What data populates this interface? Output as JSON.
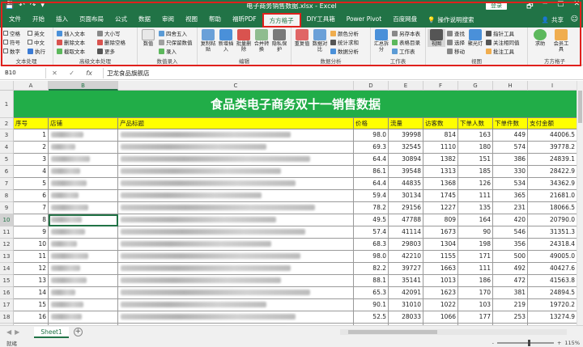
{
  "app": {
    "title": "电子商务销售数据.xlsx - Excel",
    "login_label": "登录",
    "quick_access": [
      "💾",
      "↶",
      "↷",
      "▾"
    ],
    "window_controls": [
      "🗗",
      "─",
      "▢",
      "✕"
    ]
  },
  "tabs": {
    "items": [
      "文件",
      "开始",
      "插入",
      "页面布局",
      "公式",
      "数据",
      "审阅",
      "视图",
      "帮助",
      "福昕PDF",
      "方方格子",
      "DIY工具箱",
      "Power Pivot",
      "百度网盘"
    ],
    "active": "方方格子",
    "search_label": "操作说明搜索",
    "share_label": "共享"
  },
  "ribbon": {
    "text_group": {
      "label": "文本处理",
      "checks": [
        "空格",
        "英文",
        "符号",
        "中文",
        "数字",
        "执行"
      ]
    },
    "adv_text_group": {
      "label": "高级文本处理",
      "items": [
        "插入文本",
        "大小写",
        "删除文本",
        "删除空格",
        "截取文本",
        "更多"
      ]
    },
    "number_group": {
      "label": "数值录入",
      "items": [
        "四舍五入",
        "只保留数值",
        "录入"
      ],
      "big": "数值"
    },
    "edit_group": {
      "label": "编辑",
      "bigs": [
        "复制粘贴",
        "新增插入",
        "批量删除",
        "合并转换",
        "隐私保护"
      ]
    },
    "analysis_group": {
      "label": "数据分析",
      "bigs": [
        "重复值",
        "数据对比"
      ],
      "items": [
        "颜色分析",
        "统计求和",
        "数据分析"
      ]
    },
    "sheet_group": {
      "label": "工作表",
      "bigs": [
        "汇总拆分"
      ],
      "items": [
        "另存本表",
        "表格目录",
        "工作表"
      ]
    },
    "view_group": {
      "label": "视图",
      "bigs": [
        "视图",
        "聚光灯",
        "记忆"
      ],
      "items": [
        "查找",
        "选择",
        "移动",
        "指针工具",
        "关注相同值",
        "批注工具"
      ]
    },
    "fangge_group": {
      "label": "方方格子",
      "bigs": [
        "求助",
        "会员工具"
      ]
    }
  },
  "formula_bar": {
    "name_box": "B10",
    "buttons": [
      "✕",
      "✓"
    ],
    "fx": "fx",
    "content": "卫龙食品旗舰店"
  },
  "sheet": {
    "columns": [
      "A",
      "B",
      "C",
      "D",
      "E",
      "F",
      "G",
      "H",
      "I"
    ],
    "row_numbers": [
      "1",
      "2",
      "3",
      "4",
      "5",
      "6",
      "7",
      "8",
      "9",
      "10",
      "11",
      "12",
      "13",
      "14",
      "15",
      "16",
      "17",
      "18",
      "19"
    ],
    "title": "食品类电子商务双十一销售数据",
    "headers": [
      "序号",
      "店铺",
      "产品标题",
      "价格",
      "流量",
      "访客数",
      "下单人数",
      "下单件数",
      "支付金额"
    ],
    "rows": [
      [
        "1",
        "98.0",
        "39998",
        "814",
        "163",
        "449",
        "44006.5"
      ],
      [
        "2",
        "69.3",
        "32545",
        "1110",
        "180",
        "574",
        "39778.2"
      ],
      [
        "3",
        "64.4",
        "30894",
        "1382",
        "151",
        "386",
        "24839.1"
      ],
      [
        "4",
        "86.1",
        "39548",
        "1313",
        "185",
        "330",
        "28422.9"
      ],
      [
        "5",
        "64.4",
        "44835",
        "1368",
        "126",
        "534",
        "34362.9"
      ],
      [
        "6",
        "59.4",
        "30134",
        "1745",
        "111",
        "365",
        "21681.0"
      ],
      [
        "7",
        "78.2",
        "29156",
        "1227",
        "135",
        "231",
        "18066.5"
      ],
      [
        "8",
        "49.5",
        "47788",
        "809",
        "164",
        "420",
        "20790.0"
      ],
      [
        "9",
        "57.4",
        "41114",
        "1673",
        "90",
        "546",
        "31351.3"
      ],
      [
        "10",
        "68.3",
        "29803",
        "1304",
        "198",
        "356",
        "24318.4"
      ],
      [
        "11",
        "98.0",
        "42210",
        "1155",
        "171",
        "500",
        "49005.0"
      ],
      [
        "12",
        "82.2",
        "39727",
        "1663",
        "111",
        "492",
        "40427.6"
      ],
      [
        "13",
        "88.1",
        "35141",
        "1013",
        "186",
        "472",
        "41563.8"
      ],
      [
        "14",
        "65.3",
        "42091",
        "1623",
        "170",
        "381",
        "24894.5"
      ],
      [
        "15",
        "90.1",
        "31010",
        "1022",
        "103",
        "219",
        "19720.2"
      ],
      [
        "16",
        "52.5",
        "28033",
        "1066",
        "177",
        "253",
        "13274.9"
      ],
      [
        "17",
        "89.1",
        "44338",
        "1751",
        "117",
        "378",
        "33679.8"
      ]
    ],
    "selected_cell": "B10"
  },
  "sheet_tabs": {
    "items": [
      "Sheet1"
    ],
    "add_label": "+"
  },
  "status": {
    "ready": "就绪",
    "zoom": "115%",
    "zoom_minus": "-",
    "zoom_plus": "+"
  }
}
